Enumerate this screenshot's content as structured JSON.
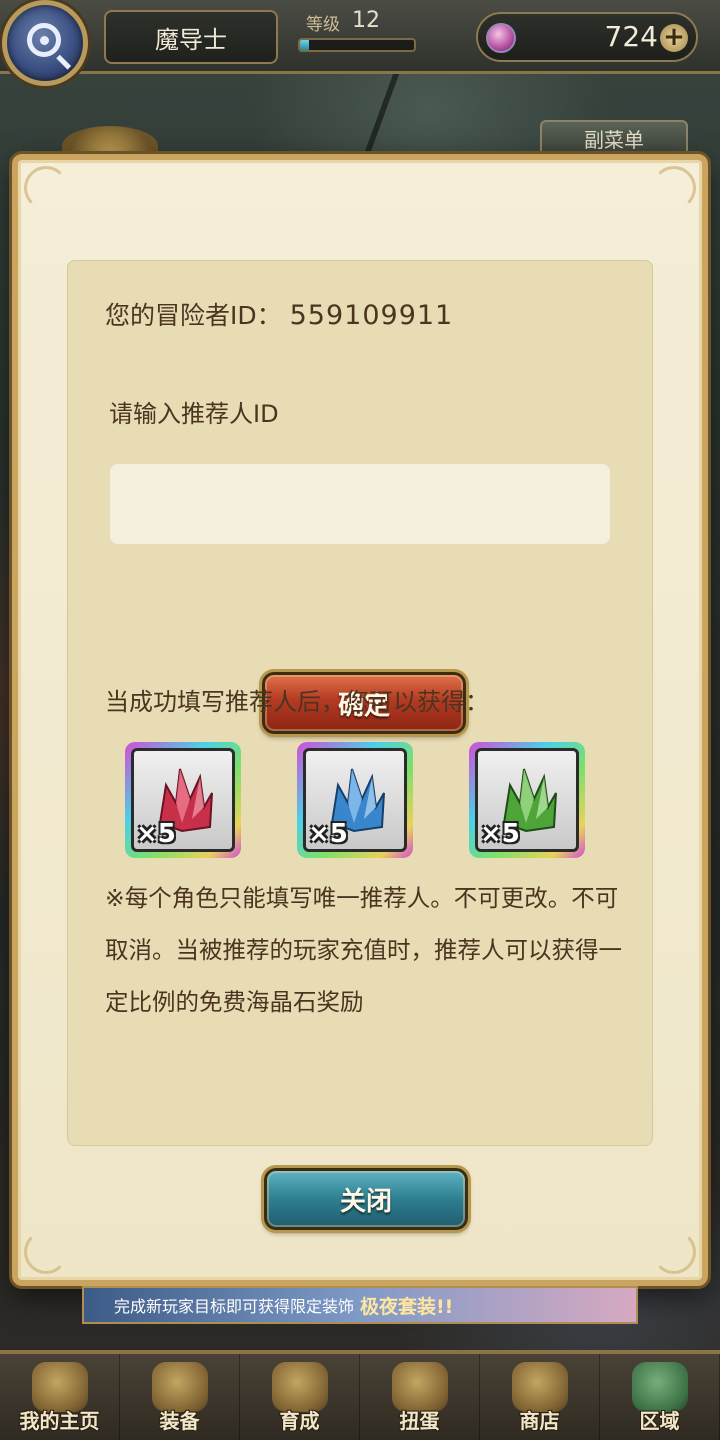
{
  "header": {
    "player_name": "魔导士",
    "level_label": "等级",
    "level": "12",
    "level_progress": 0.08,
    "gem_count": "724",
    "plus_label": "+",
    "submenu_label": "副菜单"
  },
  "dialog": {
    "id_label": "您的冒险者ID：",
    "id_value": "559109911",
    "prompt": "请输入推荐人ID",
    "input_value": "",
    "input_placeholder": "",
    "confirm_label": "确定",
    "reward_title": "当成功填写推荐人后，您可以获得：",
    "rewards": [
      {
        "name": "red-crystal-icon",
        "count": "×5",
        "color": "#d2354d"
      },
      {
        "name": "blue-crystal-icon",
        "count": "×5",
        "color": "#3f8fd1"
      },
      {
        "name": "green-crystal-icon",
        "count": "×5",
        "color": "#4da53a"
      }
    ],
    "note": "※每个角色只能填写唯一推荐人。不可更改。不可取消。当被推荐的玩家充值时，推荐人可以获得一定比例的免费海晶石奖励",
    "close_label": "关闭"
  },
  "banner": {
    "text": "完成新玩家目标即可获得限定装饰",
    "highlight": "极夜套装!!"
  },
  "bottom_nav": [
    {
      "label": "我的主页",
      "icon": "home-scroll-icon"
    },
    {
      "label": "装备",
      "icon": "armor-helmet-icon"
    },
    {
      "label": "育成",
      "icon": "training-sword-icon"
    },
    {
      "label": "扭蛋",
      "icon": "gacha-bag-icon"
    },
    {
      "label": "商店",
      "icon": "shop-bag-icon"
    },
    {
      "label": "区域",
      "icon": "globe-icon"
    }
  ],
  "colors": {
    "accent_gold": "#c9a55f",
    "confirm_red": "#b43a22",
    "close_teal": "#2e7f91"
  }
}
